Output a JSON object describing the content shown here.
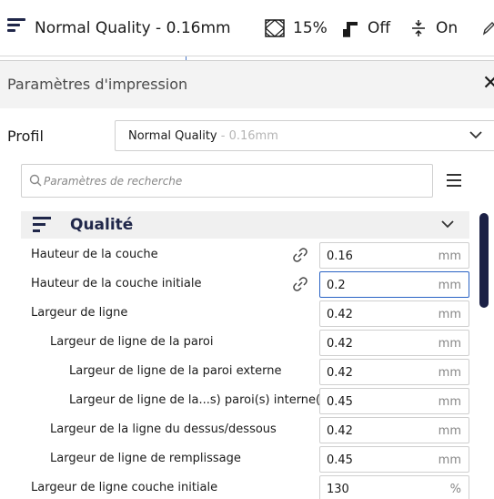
{
  "topbar": {
    "profile_name": "Normal Quality - 0.16mm",
    "infill_value": "15%",
    "support_value": "Off",
    "adhesion_value": "On"
  },
  "panel": {
    "title": "Paramètres d'impression",
    "profile_label": "Profil",
    "profile_select_name": "Normal Quality",
    "profile_select_suffix": " - 0.16mm",
    "search_placeholder": "Paramètres de recherche",
    "section_title": "Qualité",
    "settings": [
      {
        "label": "Hauteur de la couche",
        "value": "0.16",
        "unit": "mm"
      },
      {
        "label": "Hauteur de la couche initiale",
        "value": "0.2",
        "unit": "mm"
      },
      {
        "label": "Largeur de ligne",
        "value": "0.42",
        "unit": "mm"
      },
      {
        "label": "Largeur de ligne de la paroi",
        "value": "0.42",
        "unit": "mm"
      },
      {
        "label": "Largeur de ligne de la paroi externe",
        "value": "0.42",
        "unit": "mm"
      },
      {
        "label": "Largeur de ligne de la...s) paroi(s) interne(s)",
        "value": "0.45",
        "unit": "mm"
      },
      {
        "label": "Largeur de la ligne du dessus/dessous",
        "value": "0.42",
        "unit": "mm"
      },
      {
        "label": "Largeur de ligne de remplissage",
        "value": "0.45",
        "unit": "mm"
      },
      {
        "label": "Largeur de ligne couche initiale",
        "value": "130",
        "unit": "%"
      }
    ]
  },
  "colors": {
    "accent_navy": "#20274a",
    "active_border": "#2a63c4"
  }
}
